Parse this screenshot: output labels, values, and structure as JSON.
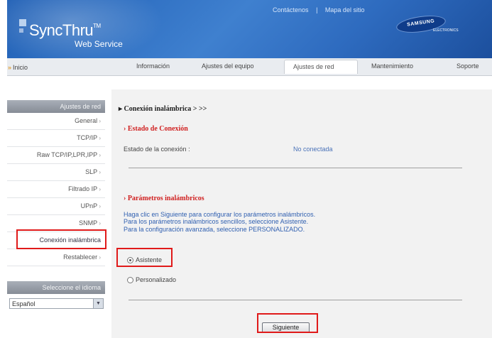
{
  "header": {
    "brand": "SyncThru",
    "brand_tm": "TM",
    "brand_sub": "Web Service",
    "links": [
      "Contáctenos",
      "|",
      "Mapa del sitio"
    ],
    "samsung": "SAMSUNG",
    "electronics": "ELECTRONICS"
  },
  "nav": {
    "home": "Inicio",
    "tabs": [
      "Información",
      "Ajustes del equipo",
      "Ajustes de red",
      "Mantenimiento",
      "Soporte"
    ],
    "active_tab": "Ajustes de red"
  },
  "sidebar": {
    "heading": "Ajustes de red",
    "items": [
      "General",
      "TCP/IP",
      "Raw TCP/IP,LPR,IPP",
      "SLP",
      "Filtrado IP",
      "UPnP",
      "SNMP",
      "Conexión inalámbrica",
      "Restablecer"
    ],
    "active_item": "Conexión inalámbrica",
    "language_heading": "Seleccione el idioma",
    "language_value": "Español"
  },
  "main": {
    "breadcrumb": "Conexión inalámbrica > >>",
    "status_title": "Estado de Conexión",
    "status_label": "Estado de la conexión :",
    "status_value": "No conectada",
    "params_title": "Parámetros inalámbricos",
    "instructions": [
      "Haga clic en Siguiente para configurar los parámetros inalámbricos.",
      "Para los parámetros inalámbricos sencillos, seleccione Asistente.",
      "Para la configuración avanzada, seleccione PERSONALIZADO."
    ],
    "option_wizard": "Asistente",
    "option_custom": "Personalizado",
    "selected_option": "Asistente",
    "next_button": "Siguiente"
  },
  "colors": {
    "header_blue": "#2e6bbf",
    "highlight_red": "#e01a1a",
    "section_title_red": "#d02020",
    "instruction_blue": "#2f5fb0"
  }
}
